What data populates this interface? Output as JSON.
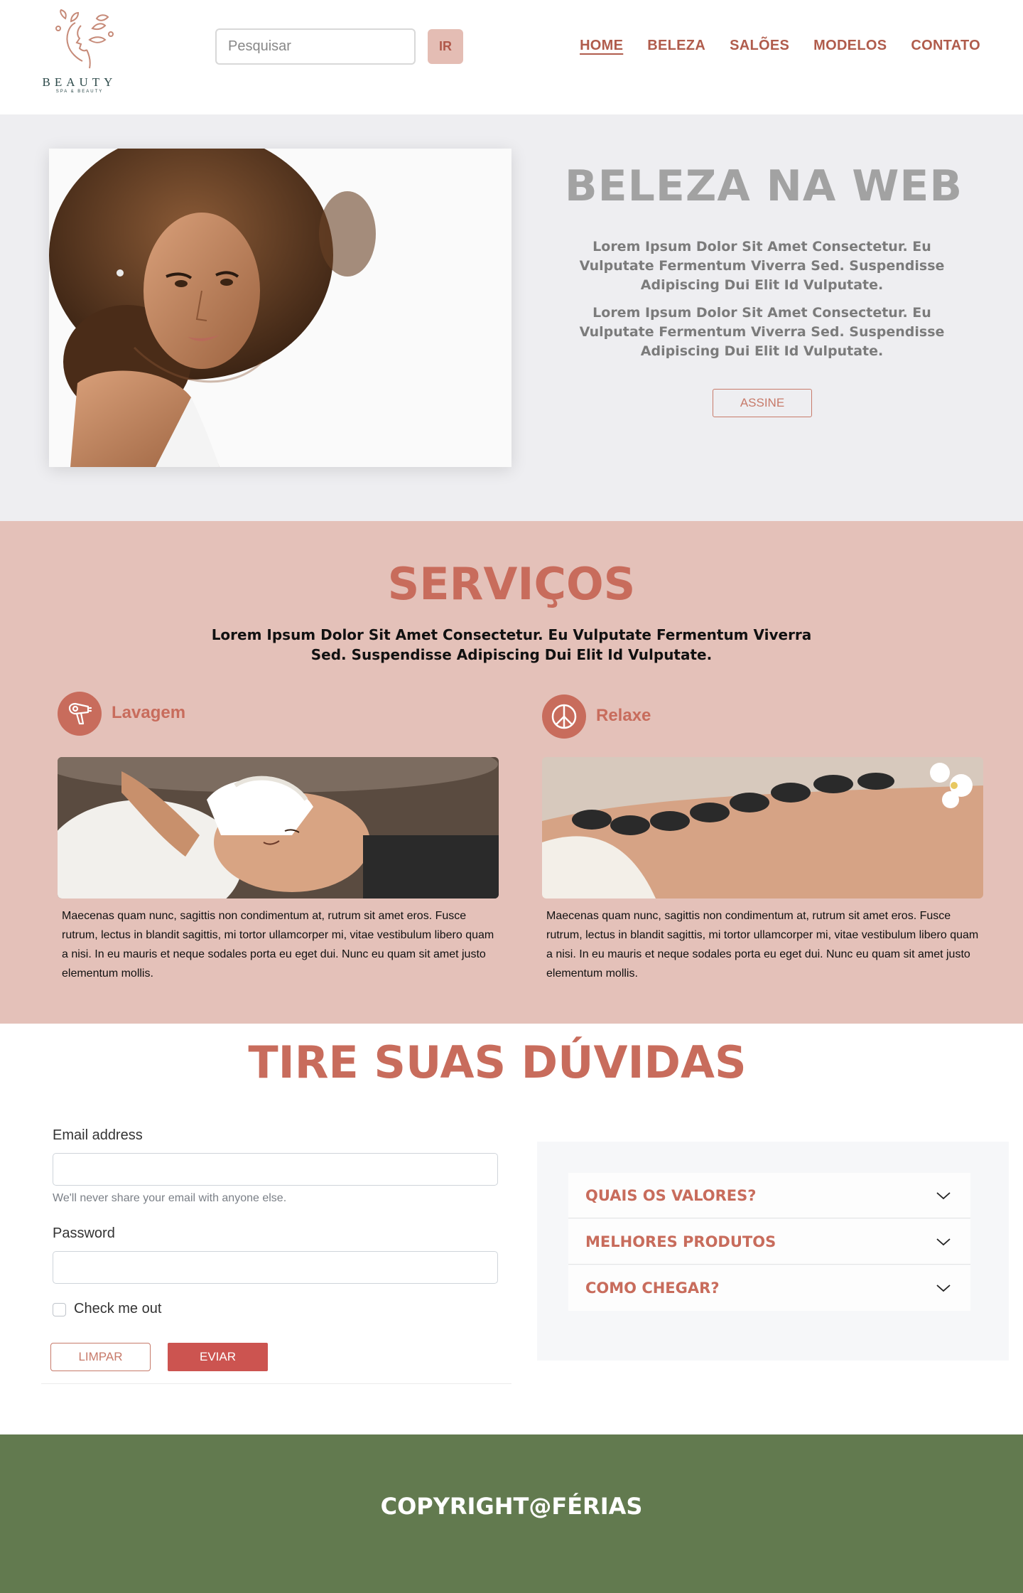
{
  "brand": {
    "name": "BEAUTY",
    "tagline": "SPA & BEAUTY"
  },
  "search": {
    "placeholder": "Pesquisar",
    "button_label": "IR"
  },
  "nav": {
    "items": [
      {
        "label": "HOME"
      },
      {
        "label": "BELEZA"
      },
      {
        "label": "SALÕES"
      },
      {
        "label": "MODELOS"
      },
      {
        "label": "CONTATO"
      }
    ],
    "active": "HOME"
  },
  "hero": {
    "title": "BELEZA NA WEB",
    "paragraphs": [
      "Lorem Ipsum Dolor Sit Amet Consectetur. Eu Vulputate Fermentum Viverra Sed. Suspendisse Adipiscing Dui Elit Id Vulputate.",
      "Lorem Ipsum Dolor Sit Amet Consectetur. Eu Vulputate Fermentum Viverra Sed. Suspendisse Adipiscing Dui Elit Id Vulputate."
    ],
    "button_label": "ASSINE"
  },
  "services": {
    "title": "SERVIÇOS",
    "subtitle": "Lorem Ipsum Dolor Sit Amet Consectetur. Eu Vulputate Fermentum Viverra Sed. Suspendisse Adipiscing Dui Elit Id Vulputate.",
    "items": [
      {
        "label": "Lavagem",
        "icon": "hair-dryer-icon",
        "text": "Maecenas quam nunc, sagittis non condimentum at, rutrum sit amet eros. Fusce rutrum, lectus in blandit sagittis, mi tortor ullamcorper mi, vitae vestibulum libero quam a nisi. In eu mauris et neque sodales porta eu eget dui. Nunc eu quam sit amet justo elementum mollis."
      },
      {
        "label": "Relaxe",
        "icon": "peace-icon",
        "text": "Maecenas quam nunc, sagittis non condimentum at, rutrum sit amet eros. Fusce rutrum, lectus in blandit sagittis, mi tortor ullamcorper mi, vitae vestibulum libero quam a nisi. In eu mauris et neque sodales porta eu eget dui. Nunc eu quam sit amet justo elementum mollis."
      }
    ]
  },
  "faq": {
    "title": "TIRE SUAS DÚVIDAS",
    "form": {
      "email_label": "Email address",
      "email_value": "",
      "email_hint": "We'll never share your email with anyone else.",
      "password_label": "Password",
      "password_value": "",
      "checkbox_label": "Check me out",
      "checkbox_checked": false,
      "clear_label": "LIMPAR",
      "submit_label": "EVIAR"
    },
    "accordion": [
      {
        "label": "QUAIS OS VALORES?"
      },
      {
        "label": "MELHORES PRODUTOS"
      },
      {
        "label": "COMO CHEGAR?"
      }
    ]
  },
  "footer": {
    "text": "COPYRIGHT@FÉRIAS"
  },
  "colors": {
    "accent": "#c86c5c",
    "nav": "#b05c4c",
    "services_bg": "#e4c1b9",
    "hero_bg": "#eeeef1",
    "footer_bg": "#627a4f",
    "submit_bg": "#cc5450"
  }
}
